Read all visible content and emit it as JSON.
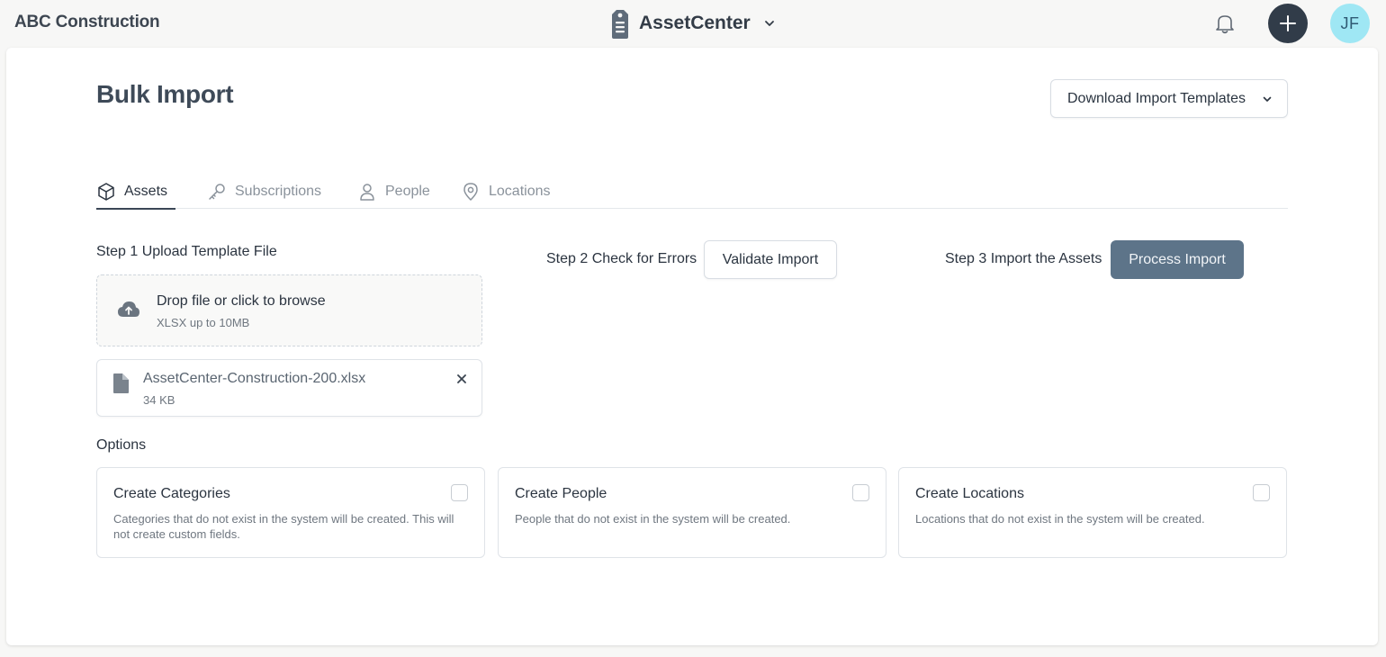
{
  "topbar": {
    "org_name": "ABC Construction",
    "app_name": "AssetCenter",
    "avatar_initials": "JF"
  },
  "page": {
    "title": "Bulk Import",
    "download_templates_label": "Download Import Templates"
  },
  "tabs": [
    {
      "label": "Assets",
      "icon": "box-icon",
      "active": true
    },
    {
      "label": "Subscriptions",
      "icon": "key-icon",
      "active": false
    },
    {
      "label": "People",
      "icon": "person-icon",
      "active": false
    },
    {
      "label": "Locations",
      "icon": "map-pin-icon",
      "active": false
    }
  ],
  "step1": {
    "label": "Step 1 Upload Template File",
    "dropzone_title": "Drop file or click to browse",
    "dropzone_hint": "XLSX up to 10MB",
    "file_name": "AssetCenter-Construction-200.xlsx",
    "file_size": "34 KB"
  },
  "step2": {
    "label": "Step 2 Check for Errors",
    "button_label": "Validate Import"
  },
  "step3": {
    "label": "Step 3 Import the Assets",
    "button_label": "Process Import"
  },
  "options": {
    "label": "Options",
    "items": [
      {
        "title": "Create Categories",
        "description": "Categories that do not exist in the system will be created. This will not create custom fields.",
        "checked": false
      },
      {
        "title": "Create People",
        "description": "People that do not exist in the system will be created.",
        "checked": false
      },
      {
        "title": "Create Locations",
        "description": "Locations that do not exist in the system will be created.",
        "checked": false
      }
    ]
  },
  "colors": {
    "accent_dark": "#313c49",
    "avatar_bg": "#9fe7f4",
    "process_button": "#5d7489",
    "page_bg": "#f7f7f6"
  }
}
